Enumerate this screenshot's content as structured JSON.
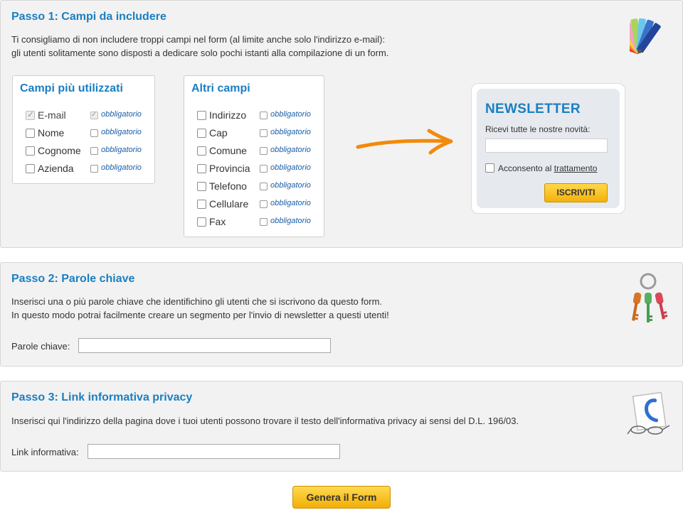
{
  "step1": {
    "title": "Passo 1: Campi da includere",
    "desc_line1": "Ti consigliamo di non includere troppi campi nel form (al limite anche solo l'indirizzo e-mail):",
    "desc_line2": "gli utenti solitamente sono disposti a dedicare solo pochi istanti alla compilazione di un form.",
    "icon": "color-swatch-icon",
    "popular": {
      "title": "Campi più utilizzati",
      "fields": [
        {
          "label": "E-mail",
          "checked": true,
          "required_label": "obbligatorio",
          "required_checked": true
        },
        {
          "label": "Nome",
          "checked": false,
          "required_label": "obbligatorio",
          "required_checked": false
        },
        {
          "label": "Cognome",
          "checked": false,
          "required_label": "obbligatorio",
          "required_checked": false
        },
        {
          "label": "Azienda",
          "checked": false,
          "required_label": "obbligatorio",
          "required_checked": false
        }
      ]
    },
    "other": {
      "title": "Altri campi",
      "fields": [
        {
          "label": "Indirizzo",
          "checked": false,
          "required_label": "obbligatorio",
          "required_checked": false
        },
        {
          "label": "Cap",
          "checked": false,
          "required_label": "obbligatorio",
          "required_checked": false
        },
        {
          "label": "Comune",
          "checked": false,
          "required_label": "obbligatorio",
          "required_checked": false
        },
        {
          "label": "Provincia",
          "checked": false,
          "required_label": "obbligatorio",
          "required_checked": false
        },
        {
          "label": "Telefono",
          "checked": false,
          "required_label": "obbligatorio",
          "required_checked": false
        },
        {
          "label": "Cellulare",
          "checked": false,
          "required_label": "obbligatorio",
          "required_checked": false
        },
        {
          "label": "Fax",
          "checked": false,
          "required_label": "obbligatorio",
          "required_checked": false
        }
      ]
    },
    "arrow_icon": "orange-arrow-icon",
    "preview": {
      "title": "NEWSLETTER",
      "field_label": "Ricevi tutte le nostre novità:",
      "input_value": "",
      "consent_text": "Acconsento al",
      "consent_link": "trattamento",
      "button": "ISCRIVITI"
    }
  },
  "step2": {
    "title": "Passo 2: Parole chiave",
    "desc_line1": "Inserisci una o più parole chiave che identifichino gli utenti che si iscrivono da questo form.",
    "desc_line2": "In questo modo potrai facilmente creare un segmento per l'invio di newsletter a questi utenti!",
    "icon": "keys-icon",
    "input_label": "Parole chiave:",
    "input_value": ""
  },
  "step3": {
    "title": "Passo 3: Link informativa privacy",
    "desc_line1": "Inserisci qui l'indirizzo della pagina dove i tuoi utenti possono trovare il testo dell'informativa privacy ai sensi del D.L. 196/03.",
    "icon": "document-glasses-icon",
    "input_label": "Link informativa:",
    "input_value": ""
  },
  "generate_button": "Genera il Form",
  "colors": {
    "title_blue": "#1a7fc1",
    "panel_bg": "#f2f2f2",
    "button_yellow": "#f5b90f",
    "arrow_orange": "#f28a0c"
  }
}
